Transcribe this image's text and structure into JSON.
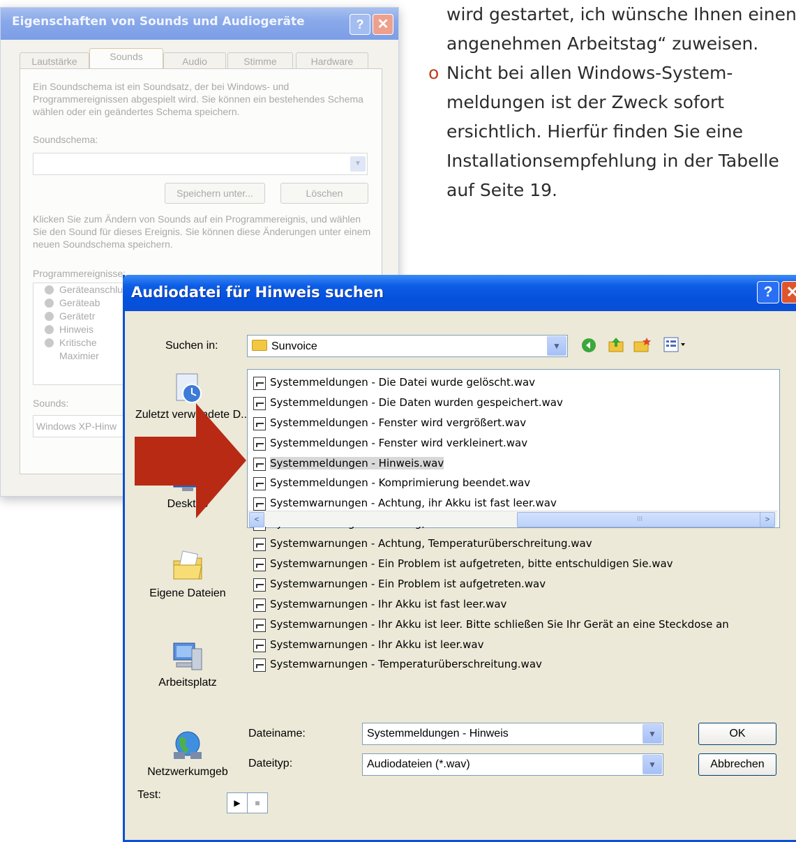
{
  "manual": {
    "line1": "wird gestartet, ich wünsche Ihnen einen",
    "line2": "angenehmen Arbeitstag“ zuweisen.",
    "bullet": "o",
    "b1": "Nicht bei allen Windows-System-",
    "b2": "meldungen ist der Zweck sofort",
    "b3": "ersichtlich.  Hierfür finden Sie eine",
    "b4": "Installationsempfehlung in der Tabelle",
    "b5": "auf Seite 19."
  },
  "back_dialog": {
    "title": "Eigenschaften von Sounds und Audiogeräte",
    "help": "?",
    "close": "✕",
    "tabs": [
      "Lautstärke",
      "Sounds",
      "Audio",
      "Stimme",
      "Hardware"
    ],
    "intro": "Ein Soundschema ist ein Soundsatz, der bei Windows- und Programmereignissen abgespielt wird. Sie können ein bestehendes Schema wählen oder ein geändertes Schema speichern.",
    "scheme_label": "Soundschema:",
    "save_as": "Speichern unter...",
    "delete": "Löschen",
    "change_text": "Klicken Sie zum Ändern von Sounds auf ein Programmereignis, und wählen Sie den Sound für dieses Ereignis. Sie können diese Änderungen unter einem neuen Soundschema speichern.",
    "events_label": "Programmereignisse:",
    "events": [
      "Geräteanschluss",
      "Geräteab",
      "Gerätetr",
      "Hinweis",
      "Kritische",
      "Maximier"
    ],
    "sounds_label": "Sounds:",
    "sounds_value": "Windows XP-Hinw"
  },
  "dialog": {
    "title": "Audiodatei für Hinweis suchen",
    "help": "?",
    "close": "✕",
    "look_in_label": "Suchen in:",
    "look_in_value": "Sunvoice",
    "places": [
      "Zuletzt verwendete D...",
      "Desktop",
      "Eigene Dateien",
      "Arbeitsplatz",
      "Netzwerkumgeb"
    ],
    "files": [
      "Systemmeldungen - Die Datei wurde gelöscht.wav",
      "Systemmeldungen - Die Daten wurden gespeichert.wav",
      "Systemmeldungen - Fenster wird vergrößert.wav",
      "Systemmeldungen - Fenster wird verkleinert.wav",
      "Systemmeldungen - Hinweis.wav",
      "Systemmeldungen - Komprimierung beendet.wav",
      "Systemwarnungen - Achtung, ihr Akku ist fast leer.wav",
      "Systemwarnungen - Achtung, ihr Akku ist leer.wav",
      "Systemwarnungen - Achtung, Temperaturüberschreitung.wav",
      "Systemwarnungen - Ein Problem ist aufgetreten, bitte entschuldigen Sie.wav",
      "Systemwarnungen - Ein Problem ist aufgetreten.wav",
      "Systemwarnungen - Ihr Akku ist fast leer.wav",
      "Systemwarnungen - Ihr Akku ist leer. Bitte schließen Sie Ihr Gerät an eine Steckdose an",
      "Systemwarnungen - Ihr Akku ist leer.wav",
      "Systemwarnungen - Temperaturüberschreitung.wav"
    ],
    "selected_file": "Systemmeldungen - Hinweis.wav",
    "filename_label": "Dateiname:",
    "filename_value": "Systemmeldungen - Hinweis",
    "filetype_label": "Dateityp:",
    "filetype_value": "Audiodateien (*.wav)",
    "ok": "OK",
    "cancel": "Abbrechen",
    "test_label": "Test:",
    "scroll_left": "<",
    "scroll_right": ">",
    "scroll_grip": "III"
  },
  "colors": {
    "title_blue": "#0a4fd6",
    "arrow_red": "#b82a14",
    "bullet_orange": "#b9431f"
  }
}
